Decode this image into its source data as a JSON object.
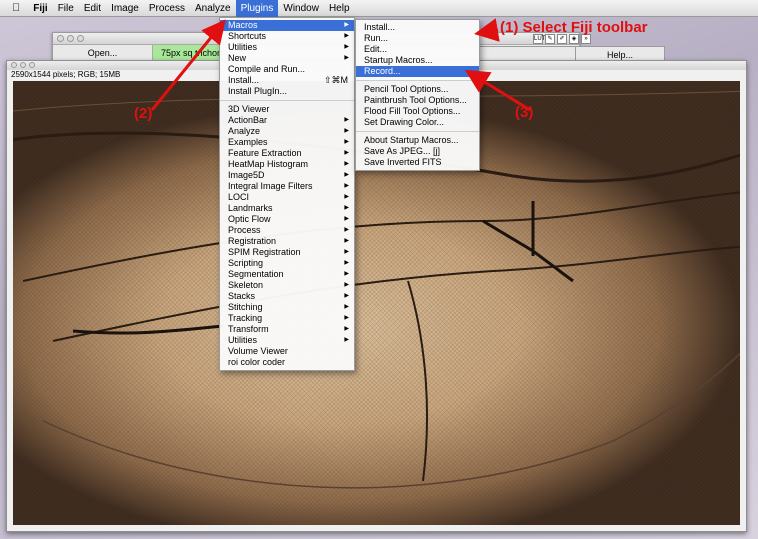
{
  "menubar": {
    "apple": "",
    "app": "Fiji",
    "items": [
      "File",
      "Edit",
      "Image",
      "Process",
      "Analyze",
      "Plugins",
      "Window",
      "Help"
    ]
  },
  "toolbar": {
    "open_label": "Open...",
    "green_label": "75px sq trichom",
    "help_label": "Help...",
    "lut_label": "LUT"
  },
  "image_window": {
    "info": "2590x1544 pixels; RGB; 15MB"
  },
  "plugins_menu": {
    "items": [
      {
        "label": "Macros",
        "sub": true,
        "hl": true
      },
      {
        "label": "Shortcuts",
        "sub": true
      },
      {
        "label": "Utilities",
        "sub": true
      },
      {
        "label": "New",
        "sub": true
      },
      {
        "label": "Compile and Run..."
      },
      {
        "label": "Install...",
        "shortcut": "⇧⌘M"
      },
      {
        "label": "Install PlugIn..."
      },
      {
        "sep": true
      },
      {
        "label": "3D Viewer"
      },
      {
        "label": "ActionBar",
        "sub": true
      },
      {
        "label": "Analyze",
        "sub": true
      },
      {
        "label": "Examples",
        "sub": true
      },
      {
        "label": "Feature Extraction",
        "sub": true
      },
      {
        "label": "HeatMap Histogram",
        "sub": true
      },
      {
        "label": "Image5D",
        "sub": true
      },
      {
        "label": "Integral Image Filters",
        "sub": true
      },
      {
        "label": "LOCI",
        "sub": true
      },
      {
        "label": "Landmarks",
        "sub": true
      },
      {
        "label": "Optic Flow",
        "sub": true
      },
      {
        "label": "Process",
        "sub": true
      },
      {
        "label": "Registration",
        "sub": true
      },
      {
        "label": "SPIM Registration",
        "sub": true
      },
      {
        "label": "Scripting",
        "sub": true
      },
      {
        "label": "Segmentation",
        "sub": true
      },
      {
        "label": "Skeleton",
        "sub": true
      },
      {
        "label": "Stacks",
        "sub": true
      },
      {
        "label": "Stitching",
        "sub": true
      },
      {
        "label": "Tracking",
        "sub": true
      },
      {
        "label": "Transform",
        "sub": true
      },
      {
        "label": "Utilities",
        "sub": true
      },
      {
        "label": "Volume Viewer"
      },
      {
        "label": "roi color coder"
      }
    ]
  },
  "macros_menu": {
    "items": [
      {
        "label": "Install..."
      },
      {
        "label": "Run..."
      },
      {
        "label": "Edit..."
      },
      {
        "label": "Startup Macros..."
      },
      {
        "label": "Record...",
        "hl": true
      },
      {
        "sep": true
      },
      {
        "label": "Pencil Tool Options..."
      },
      {
        "label": "Paintbrush Tool Options..."
      },
      {
        "label": "Flood Fill Tool Options..."
      },
      {
        "label": "Set Drawing Color..."
      },
      {
        "sep": true
      },
      {
        "label": "About Startup Macros..."
      },
      {
        "label": "Save As JPEG... [j]"
      },
      {
        "label": "Save Inverted FITS"
      }
    ]
  },
  "annotations": {
    "step1": "(1) Select Fiji toolbar",
    "step2": "(2)",
    "step3": "(3)",
    "color": "#e01010"
  },
  "colors": {
    "highlight": "#3b6fd8",
    "toolbar_green": "#a9e89b"
  }
}
